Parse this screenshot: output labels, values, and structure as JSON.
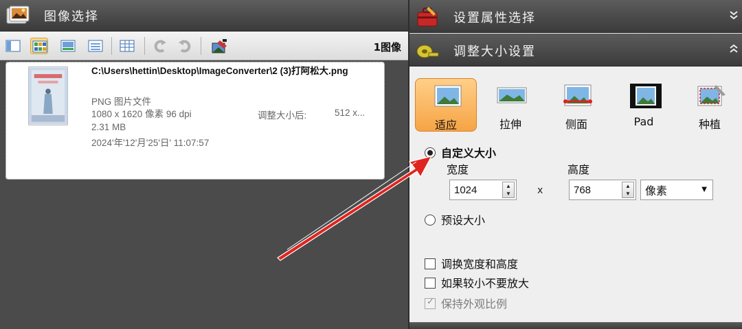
{
  "left_pane": {
    "title": "图像选择",
    "image_count": "1图像",
    "toolbar": {
      "buttons": [
        {
          "name": "view-details-icon"
        },
        {
          "name": "view-thumbnails-icon"
        },
        {
          "name": "view-filmstrip-icon"
        },
        {
          "name": "view-list-icon"
        },
        {
          "name": "view-table-icon"
        },
        {
          "name": "rotate-left-icon"
        },
        {
          "name": "rotate-right-icon"
        },
        {
          "name": "convert-icon"
        }
      ]
    },
    "file": {
      "path": "C:\\Users\\hettin\\Desktop\\ImageConverter\\2 (3)打阿松大.png",
      "type": "PNG 图片文件",
      "dimensions": "1080 x 1620 像素 96 dpi",
      "size": "2.31 MB",
      "date": "2024'年'12'月'25'日' 11:07:57",
      "resize_label": "调整大小后:",
      "resize_value": "512 x..."
    }
  },
  "right_pane": {
    "properties_header": "设置属性选择",
    "resize_header": "调整大小设置",
    "modes": [
      {
        "label": "适应",
        "icon": "fit-icon",
        "active": true
      },
      {
        "label": "拉伸",
        "icon": "stretch-icon",
        "active": false
      },
      {
        "label": "侧面",
        "icon": "side-icon",
        "active": false
      },
      {
        "label": "Pad",
        "icon": "pad-icon",
        "active": false
      },
      {
        "label": "种植",
        "icon": "crop-icon",
        "active": false
      }
    ],
    "custom_size_label": "自定义大小",
    "width_label": "宽度",
    "height_label": "高度",
    "width_value": "1024",
    "height_value": "768",
    "times": "x",
    "unit": "像素",
    "preset_label": "预设大小",
    "swap_label": "调换宽度和高度",
    "no_enlarge_label": "如果较小不要放大",
    "keep_ratio_label": "保持外观比例"
  }
}
